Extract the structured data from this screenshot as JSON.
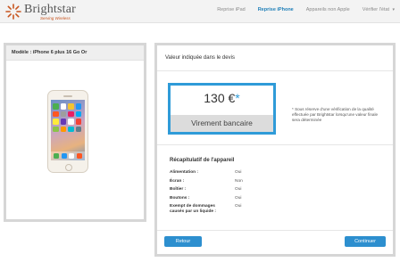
{
  "header": {
    "brand": "Brightstar",
    "tagline": "Serving Wireless",
    "nav": [
      {
        "label": "Reprise iPad",
        "active": false
      },
      {
        "label": "Reprise iPhone",
        "active": true
      },
      {
        "label": "Appareils non Apple",
        "active": false
      },
      {
        "label": "Vérifier l'état",
        "active": false
      }
    ],
    "colors": {
      "accent": "#1f7fb8",
      "brand_orange": "#c8541e"
    }
  },
  "device": {
    "model_label": "Modèle : iPhone 6 plus 16 Go Or"
  },
  "quote": {
    "title": "Valeur indiquée dans le devis",
    "price": "130 €",
    "price_mark": "*",
    "method": "Virement bancaire",
    "note": "* Sous réserve d'une vérification de la qualité effectuée par Brightstar lorsqu'une valeur finale sera déterminée"
  },
  "recap": {
    "title": "Récapitulatif de l'appareil",
    "rows": [
      {
        "label": "Alimentation :",
        "value": "Oui"
      },
      {
        "label": "Écran :",
        "value": "Non"
      },
      {
        "label": "Boîtier :",
        "value": "Oui"
      },
      {
        "label": "Boutons :",
        "value": "Oui"
      },
      {
        "label": "Exempt de dommages causés par un liquide :",
        "value": "Oui"
      }
    ]
  },
  "actions": {
    "back": "Retour",
    "continue": "Continuer"
  }
}
